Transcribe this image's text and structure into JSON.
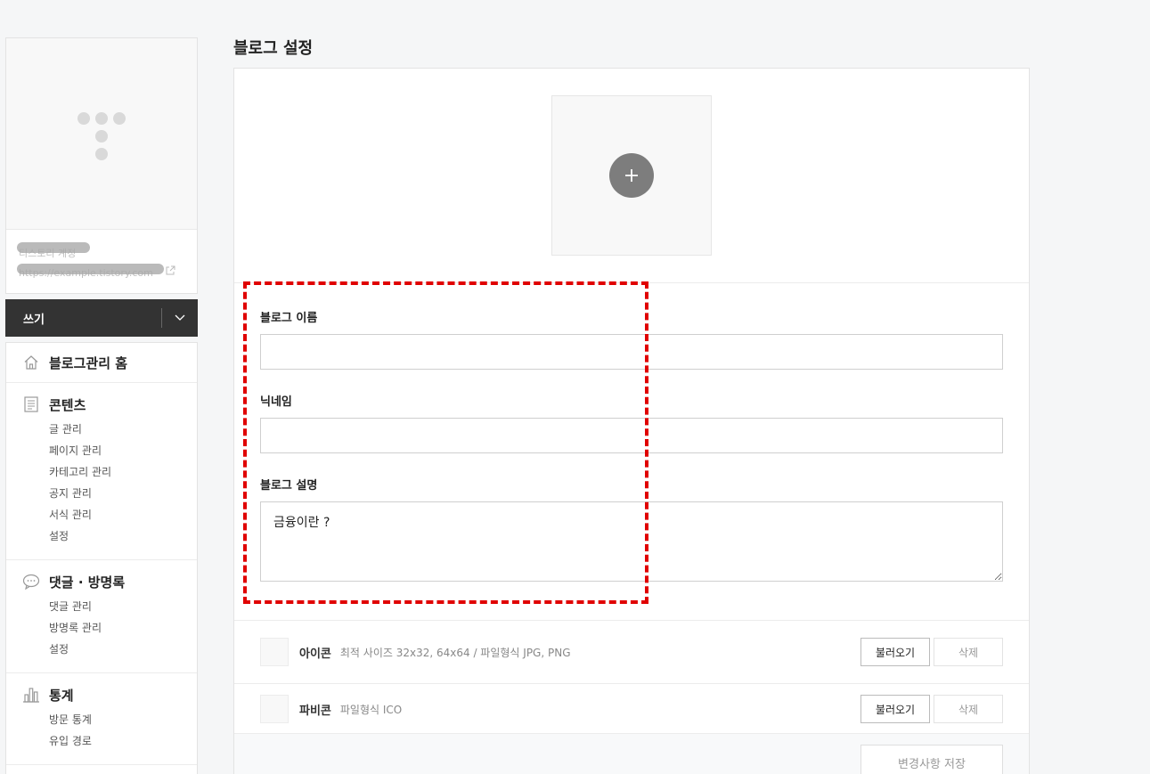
{
  "page": {
    "title": "블로그 설정"
  },
  "profile": {
    "name": "티스토리 계정",
    "url": "https://example.tistory.com"
  },
  "write": {
    "label": "쓰기"
  },
  "menu": {
    "home": {
      "label": "블로그관리 홈",
      "icon": "home-icon"
    },
    "contents": {
      "label": "콘텐츠",
      "icon": "document-icon",
      "items": [
        "글 관리",
        "페이지 관리",
        "카테고리 관리",
        "공지 관리",
        "서식 관리",
        "설정"
      ]
    },
    "comments": {
      "label": "댓글 · 방명록",
      "icon": "speech-bubble-icon",
      "items": [
        "댓글 관리",
        "방명록 관리",
        "설정"
      ]
    },
    "stats": {
      "label": "통계",
      "icon": "bar-chart-icon",
      "items": [
        "방문 통계",
        "유입 경로"
      ]
    }
  },
  "form": {
    "blog_name": {
      "label": "블로그 이름",
      "value": ""
    },
    "nickname": {
      "label": "닉네임",
      "value": ""
    },
    "description": {
      "label": "블로그 설명",
      "value": "금융이란 ?"
    }
  },
  "icon_row": {
    "label": "아이콘",
    "hint": "최적 사이즈 32x32, 64x64 / 파일형식 JPG, PNG",
    "load_label": "불러오기",
    "delete_label": "삭제"
  },
  "favicon_row": {
    "label": "파비콘",
    "hint": "파일형식 ICO",
    "load_label": "불러오기",
    "delete_label": "삭제"
  },
  "save": {
    "label": "변경사항 저장"
  },
  "colors": {
    "highlight": "#e00000",
    "write_bar": "#333333"
  }
}
